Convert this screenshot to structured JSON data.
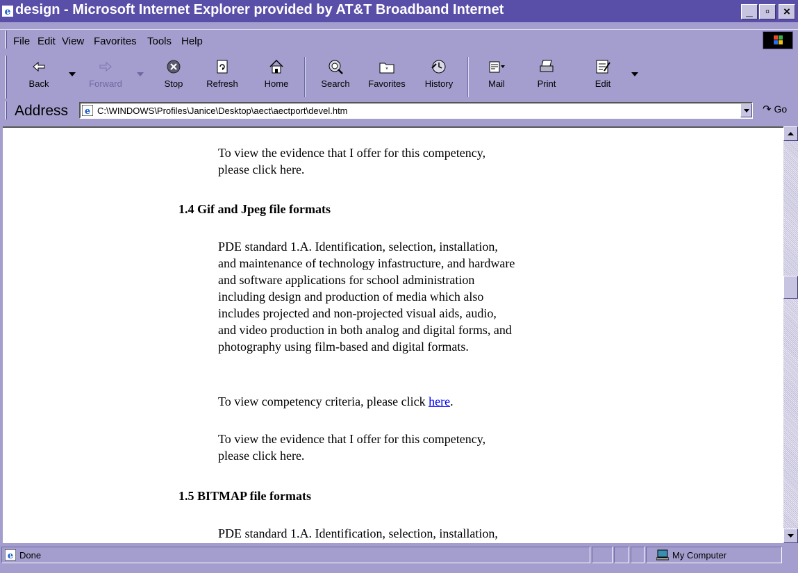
{
  "window": {
    "title": "design - Microsoft Internet Explorer provided by AT&T Broadband Internet",
    "minimize_label": "_",
    "maximize_label": "▫",
    "close_label": "×"
  },
  "menu": [
    "File",
    "Edit",
    "View",
    "Favorites",
    "Tools",
    "Help"
  ],
  "toolbar": {
    "back": "Back",
    "forward": "Forward",
    "stop": "Stop",
    "refresh": "Refresh",
    "home": "Home",
    "search": "Search",
    "favorites": "Favorites",
    "history": "History",
    "mail": "Mail",
    "print": "Print",
    "edit": "Edit"
  },
  "address": {
    "label": "Address",
    "value": "C:\\WINDOWS\\Profiles\\Janice\\Desktop\\aect\\aectport\\devel.htm",
    "go": "Go"
  },
  "content": {
    "p1_line1": "To view the evidence that I offer for this competency,",
    "p1_line2": "please click here.",
    "h14": "1.4 Gif and Jpeg file formats",
    "pde_lines": [
      "PDE standard 1.A. Identification, selection, installation,",
      "and maintenance of technology infastructure, and hardware",
      "and software applications for school administration",
      "including design and production of media which also",
      "includes projected and non-projected visual aids, audio,",
      "and video production in both analog and digital forms, and",
      "photography using film-based and digital formats."
    ],
    "criteria_prefix": "To view competency criteria, please click ",
    "criteria_link": "here",
    "criteria_suffix": ".",
    "p3_line1": "To view the evidence that I offer for this competency,",
    "p3_line2": "please click here.",
    "h15": "1.5 BITMAP file formats",
    "pde2_line1": "PDE standard 1.A. Identification, selection, installation,"
  },
  "status": {
    "text": "Done",
    "zone": "My Computer"
  }
}
